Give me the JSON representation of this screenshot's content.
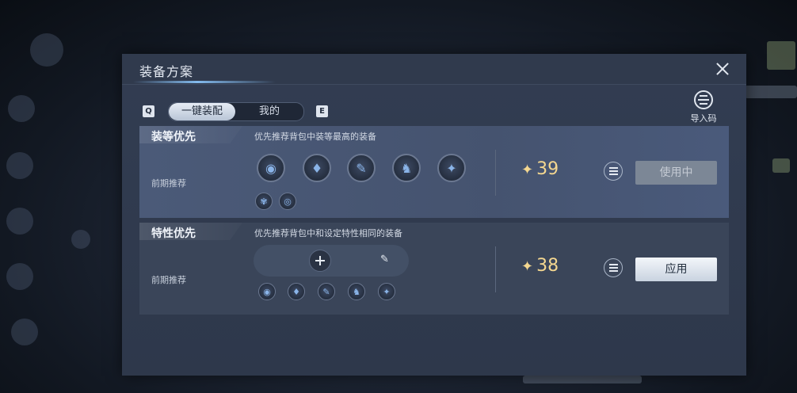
{
  "dialog": {
    "title": "装备方案",
    "tabs": [
      {
        "label": "一键装配",
        "active": true
      },
      {
        "label": "我的",
        "active": false
      }
    ],
    "key_prev": "Q",
    "key_next": "E",
    "import_label": "导入码"
  },
  "plans": [
    {
      "name": "装等优先",
      "description": "优先推荐背包中装等最高的装备",
      "sub_label": "前期推荐",
      "score": "39",
      "button_label": "使用中",
      "button_state": "in-use",
      "gear_icons": [
        "mask-icon",
        "cloak-icon",
        "bracer-icon",
        "boots-icon",
        "dress-icon"
      ],
      "accessory_icons": [
        "emblem-icon",
        "swirl-icon"
      ]
    },
    {
      "name": "特性优先",
      "description": "优先推荐背包中和设定特性相同的装备",
      "sub_label": "前期推荐",
      "score": "38",
      "button_label": "应用",
      "button_state": "apply",
      "gear_icons": [
        "mask-icon",
        "cloak-icon",
        "bracer-icon",
        "boots-icon",
        "dress-icon"
      ]
    }
  ],
  "colors": {
    "score": "#f4d790",
    "panel": "#323d52",
    "selected_plan": "#4b5a78"
  }
}
